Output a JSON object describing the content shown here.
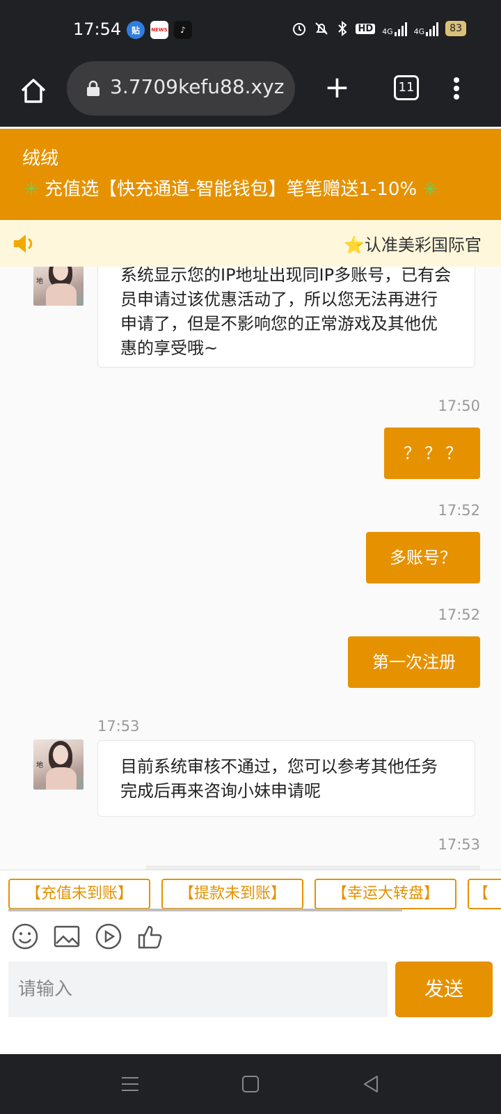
{
  "status_bar": {
    "time": "17:54",
    "battery": "83",
    "icons": [
      "tieba-icon",
      "news-app-icon",
      "tiktok-icon",
      "alarm-icon",
      "mute-bell-icon",
      "bluetooth-icon",
      "hd-icon",
      "signal-4g-icon",
      "signal-4g-icon"
    ],
    "net_label_1": "4G",
    "net_label_2": "4G",
    "hd_label": "HD"
  },
  "browser": {
    "url": "3.7709kefu88.xyz",
    "tab_count": "11"
  },
  "header": {
    "agent_name": "绒绒",
    "promo_text": "充值选【快充通道-智能钱包】笔笔赠送1-10%",
    "promo_star_left": "✳",
    "promo_star_right": "✳"
  },
  "marquee": {
    "star": "⭐",
    "text": "认准美彩国际官"
  },
  "messages": [
    {
      "from": "agent",
      "text": "系统显示您的IP地址出现同IP多账号，已有会员申请过该优惠活动了，所以您无法再进行申请了，但是不影响您的正常游戏及其他优惠的享受哦~"
    },
    {
      "from": "user",
      "time": "17:50",
      "text": "？？？"
    },
    {
      "from": "user",
      "time": "17:52",
      "text": "多账号？"
    },
    {
      "from": "user",
      "time": "17:52",
      "text": "第一次注册"
    },
    {
      "from": "agent",
      "time": "17:53",
      "text": "目前系统审核不通过，您可以参考其他任务 完成后再来咨询小妹申请呢"
    },
    {
      "from": "user",
      "time": "17:53",
      "text": ""
    }
  ],
  "quick_replies": [
    "【充值未到账】",
    "【提款未到账】",
    "【幸运大转盘】",
    "【"
  ],
  "input": {
    "placeholder": "请输入",
    "send_label": "发送"
  },
  "colors": {
    "accent": "#e69100",
    "dark_bar": "#202124",
    "marquee_bg": "#fef7dc"
  }
}
